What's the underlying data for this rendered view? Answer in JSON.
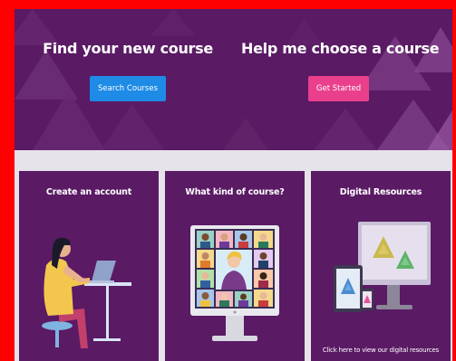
{
  "hero": {
    "find": {
      "title": "Find your new course",
      "button_label": "Search Courses"
    },
    "help": {
      "title": "Help me choose a course",
      "button_label": "Get Started"
    }
  },
  "cards": [
    {
      "title": "Create an account"
    },
    {
      "title": "What kind of course?"
    },
    {
      "title": "Digital Resources",
      "caption": "Click here to view our digital resources"
    }
  ],
  "colors": {
    "frame": "#ff0000",
    "brand_purple": "#5a1a64",
    "search_button": "#1e8be6",
    "start_button": "#ea3f8c",
    "page_background": "#e6e3ea"
  },
  "icons": {
    "card1": "person-at-laptop-illustration",
    "card2": "video-call-monitor-illustration",
    "card3": "digital-devices-illustration"
  }
}
